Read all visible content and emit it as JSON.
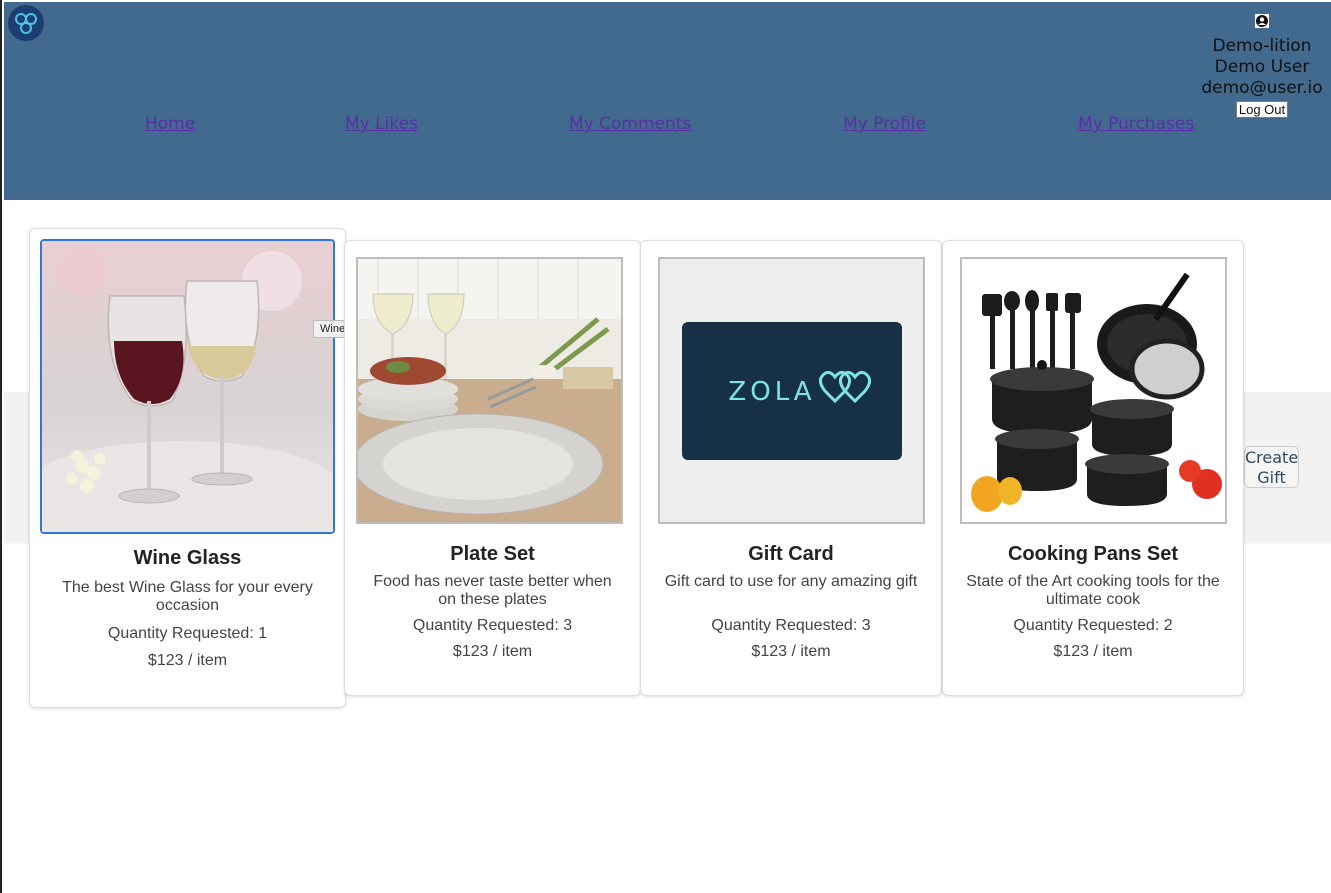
{
  "header": {
    "nav": [
      "Home",
      "My Likes",
      "My Comments",
      "My Profile",
      "My Purchases"
    ],
    "user": {
      "registry": "Demo-lition",
      "name": "Demo User",
      "email": "demo@user.io",
      "logout_label": "Log Out"
    }
  },
  "gifts": [
    {
      "title": "Wine Glass",
      "desc": "The best Wine Glass for your every occasion",
      "qty": "Quantity Requested: 1",
      "price": "$123 / item"
    },
    {
      "title": "Plate Set",
      "desc": "Food has never taste better when on these plates",
      "qty": "Quantity Requested: 3",
      "price": "$123 / item"
    },
    {
      "title": "Gift Card",
      "desc": "Gift card to use for any amazing gift",
      "qty": "Quantity Requested: 3",
      "price": "$123 / item"
    },
    {
      "title": "Cooking Pans Set",
      "desc": "State of the Art cooking tools for the ultimate cook",
      "qty": "Quantity Requested: 2",
      "price": "$123 / item"
    }
  ],
  "gift_card_logo": "ZOLA",
  "tooltip": "Wine Glass",
  "create_gift_label": "Create Gift",
  "colors": {
    "header": "#416a8e",
    "link": "#5a2ea6",
    "focus": "#2e77e0"
  }
}
